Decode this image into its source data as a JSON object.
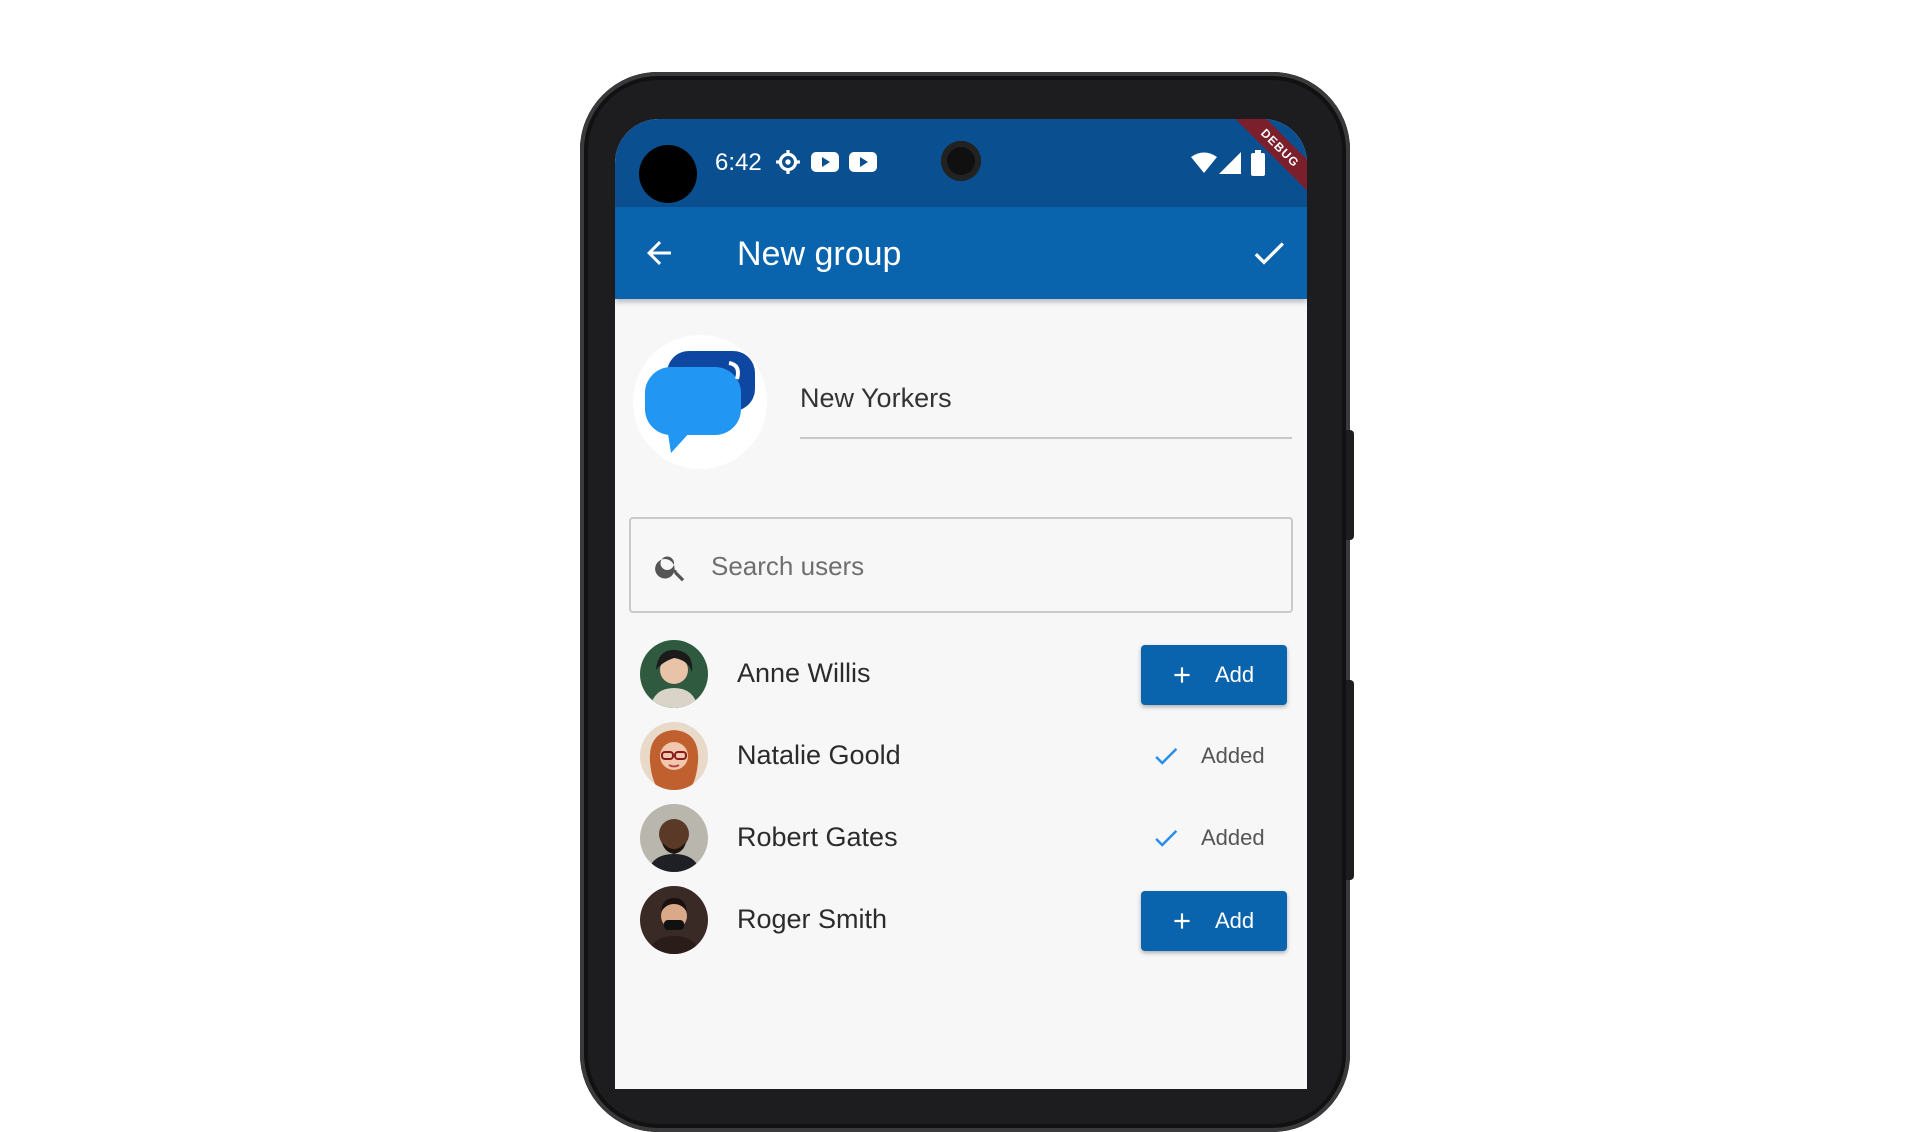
{
  "status_bar": {
    "time": "6:42",
    "icons": [
      "settings-icon",
      "youtube-icon",
      "youtube-icon",
      "wifi-icon",
      "signal-icon",
      "battery-icon"
    ],
    "debug_label": "DEBUG"
  },
  "app_bar": {
    "title": "New group",
    "back_icon": "arrow-back-icon",
    "confirm_icon": "check-icon",
    "background": "#0a63ad"
  },
  "group": {
    "name_value": "New Yorkers",
    "avatar_icon": "chat-bubbles-icon"
  },
  "search": {
    "placeholder": "Search users",
    "value": ""
  },
  "users": [
    {
      "name": "Anne Willis",
      "status": "add",
      "action_label": "Add"
    },
    {
      "name": "Natalie Goold",
      "status": "added",
      "action_label": "Added"
    },
    {
      "name": "Robert Gates",
      "status": "added",
      "action_label": "Added"
    },
    {
      "name": "Roger Smith",
      "status": "add",
      "action_label": "Add"
    }
  ],
  "colors": {
    "status_bar": "#0a4f8f",
    "primary": "#0a63ad",
    "added_check": "#2a8de8",
    "background": "#f7f7f7"
  }
}
